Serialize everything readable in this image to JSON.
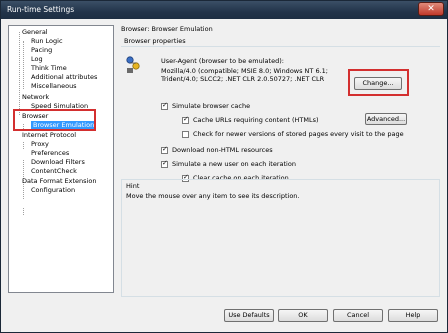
{
  "window": {
    "title": "Run-time Settings",
    "close_glyph": "✕"
  },
  "tree": {
    "items": [
      {
        "label": "General",
        "level": 0
      },
      {
        "label": "Run Logic",
        "level": 1
      },
      {
        "label": "Pacing",
        "level": 1
      },
      {
        "label": "Log",
        "level": 1
      },
      {
        "label": "Think Time",
        "level": 1
      },
      {
        "label": "Additional attributes",
        "level": 1
      },
      {
        "label": "Miscellaneous",
        "level": 1
      },
      {
        "label": "Network",
        "level": 0
      },
      {
        "label": "Speed Simulation",
        "level": 1
      },
      {
        "label": "Browser",
        "level": 0
      },
      {
        "label": "Browser Emulation",
        "level": 1,
        "selected": true
      },
      {
        "label": "Internet Protocol",
        "level": 0
      },
      {
        "label": "Proxy",
        "level": 1
      },
      {
        "label": "Preferences",
        "level": 1
      },
      {
        "label": "Download Filters",
        "level": 1
      },
      {
        "label": "ContentCheck",
        "level": 1
      },
      {
        "label": "Data Format Extension",
        "level": 0
      },
      {
        "label": "Configuration",
        "level": 1
      }
    ]
  },
  "panel": {
    "title": "Browser: Browser Emulation",
    "group_title": "Browser properties",
    "user_agent_label": "User-Agent (browser to be emulated):",
    "user_agent_value": "Mozilla/4.0 (compatible; MSIE 8.0; Windows NT 6.1; Trident/4.0; SLCC2; .NET CLR 2.0.50727; .NET CLR",
    "change_button": "Change...",
    "advanced_button": "Advanced...",
    "checkboxes": {
      "simulate_cache": {
        "label": "Simulate browser cache",
        "checked": true
      },
      "cache_urls": {
        "label": "Cache URLs requiring content (HTMLs)",
        "checked": true
      },
      "check_newer": {
        "label": "Check for newer versions of stored pages every visit to the page",
        "checked": false
      },
      "download_non_html": {
        "label": "Download non-HTML resources",
        "checked": true
      },
      "new_user": {
        "label": "Simulate a new user on each iteration",
        "checked": true
      },
      "clear_cache": {
        "label": "Clear cache on each iteration",
        "checked": true
      }
    },
    "hint_title": "Hint",
    "hint_text": "Move the mouse over any item to see its description."
  },
  "buttons": {
    "use_defaults": "Use Defaults",
    "ok": "OK",
    "cancel": "Cancel",
    "help": "Help"
  },
  "colors": {
    "selection": "#3399ff",
    "highlight_box": "#d32f2f",
    "titlebar": "#22344a"
  }
}
